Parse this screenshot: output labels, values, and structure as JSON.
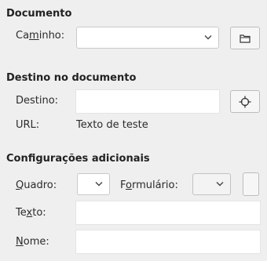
{
  "document": {
    "title": "Documento",
    "path_label_pre": "Ca",
    "path_label_mnemonic": "m",
    "path_label_post": "inho:",
    "path_value": "",
    "open_icon": "folder-icon"
  },
  "target": {
    "title": "Destino no documento",
    "target_label": "Destino:",
    "target_value": "",
    "target_icon": "crosshair-icon",
    "url_label": "URL:",
    "url_value": "Texto de teste"
  },
  "additional": {
    "title": "Configurações adicionais",
    "frame_label_mnemonic": "Q",
    "frame_label_post": "uadro:",
    "frame_value": "",
    "form_label_pre": "F",
    "form_label_mnemonic": "o",
    "form_label_post": "rmulário:",
    "form_value": "",
    "text_label_pre": "Te",
    "text_label_mnemonic": "x",
    "text_label_post": "to:",
    "text_value": "",
    "name_label_mnemonic": "N",
    "name_label_post": "ome:",
    "name_value": ""
  }
}
